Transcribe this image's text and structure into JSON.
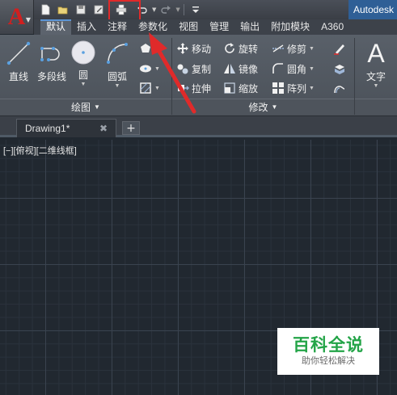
{
  "app": {
    "logo": "A",
    "window_title": "Autodesk"
  },
  "quick_access": [
    "new-file",
    "open-file",
    "save",
    "save-as",
    "plot",
    "undo",
    "redo",
    "customize"
  ],
  "ribbon_tabs": [
    "默认",
    "插入",
    "注释",
    "参数化",
    "视图",
    "管理",
    "输出",
    "附加模块",
    "A360"
  ],
  "active_tab": "默认",
  "draw_panel": {
    "title": "绘图",
    "tools": {
      "line": "直线",
      "polyline": "多段线",
      "circle": "圆",
      "arc": "圆弧"
    }
  },
  "modify_panel": {
    "title": "修改",
    "tools": {
      "move": "移动",
      "rotate": "旋转",
      "trim": "修剪",
      "copy": "复制",
      "mirror": "镜像",
      "fillet": "圆角",
      "stretch": "拉伸",
      "scale": "缩放",
      "array": "阵列"
    }
  },
  "annotation_panel": {
    "text": "文字"
  },
  "document": {
    "tab_name": "Drawing1*",
    "close_glyph": "✖",
    "new_tab_glyph": "+"
  },
  "viewport": {
    "label": "[−][俯视][二维线框]"
  },
  "watermark": {
    "title": "百科全说",
    "subtitle": "助你轻松解决"
  },
  "colors": {
    "canvas_bg": "#212830",
    "ribbon_bg": "#596069",
    "highlight": "#e02a2a",
    "watermark_green": "#23a447",
    "title_blue": "#2f5f96"
  }
}
